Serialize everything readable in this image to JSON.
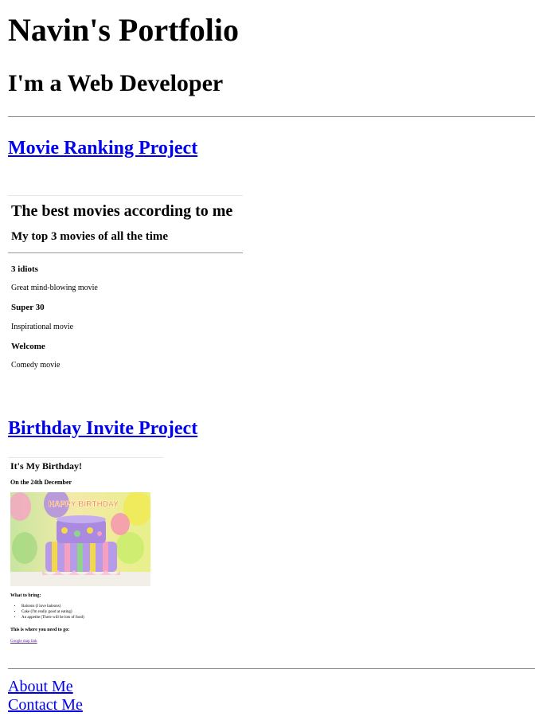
{
  "header": {
    "title": "Navin's Portfolio",
    "subtitle": "I'm a Web Developer"
  },
  "projects": {
    "movie_link": "Movie Ranking Project",
    "birthday_link": "Birthday Invite Project"
  },
  "movie_page": {
    "title": "The best movies according to me",
    "subtitle": "My top 3 movies of all the time",
    "movies": [
      {
        "name": "3 idiots",
        "description": "Great mind-blowing movie"
      },
      {
        "name": "Super 30",
        "description": "Inspirational movie"
      },
      {
        "name": "Welcome",
        "description": "Comedy movie"
      }
    ]
  },
  "birthday_page": {
    "title": "It's My Birthday!",
    "date": "On the 24th December",
    "cake_text": "HAPPY BIRTHDAY",
    "bring_heading": "What to bring:",
    "bring_items": [
      "Baloons (I love baloons)",
      "Cake (I'm really good at eating)",
      "An appetite (There will be lots of food)"
    ],
    "where_heading": "This is where you need to go:",
    "map_link": "Google map link"
  },
  "footer": {
    "about": "About Me",
    "contact": "Contact Me"
  },
  "colors": {
    "link": "#0000ee",
    "visited_link": "#551a8b",
    "rule": "#8a8a8a"
  }
}
